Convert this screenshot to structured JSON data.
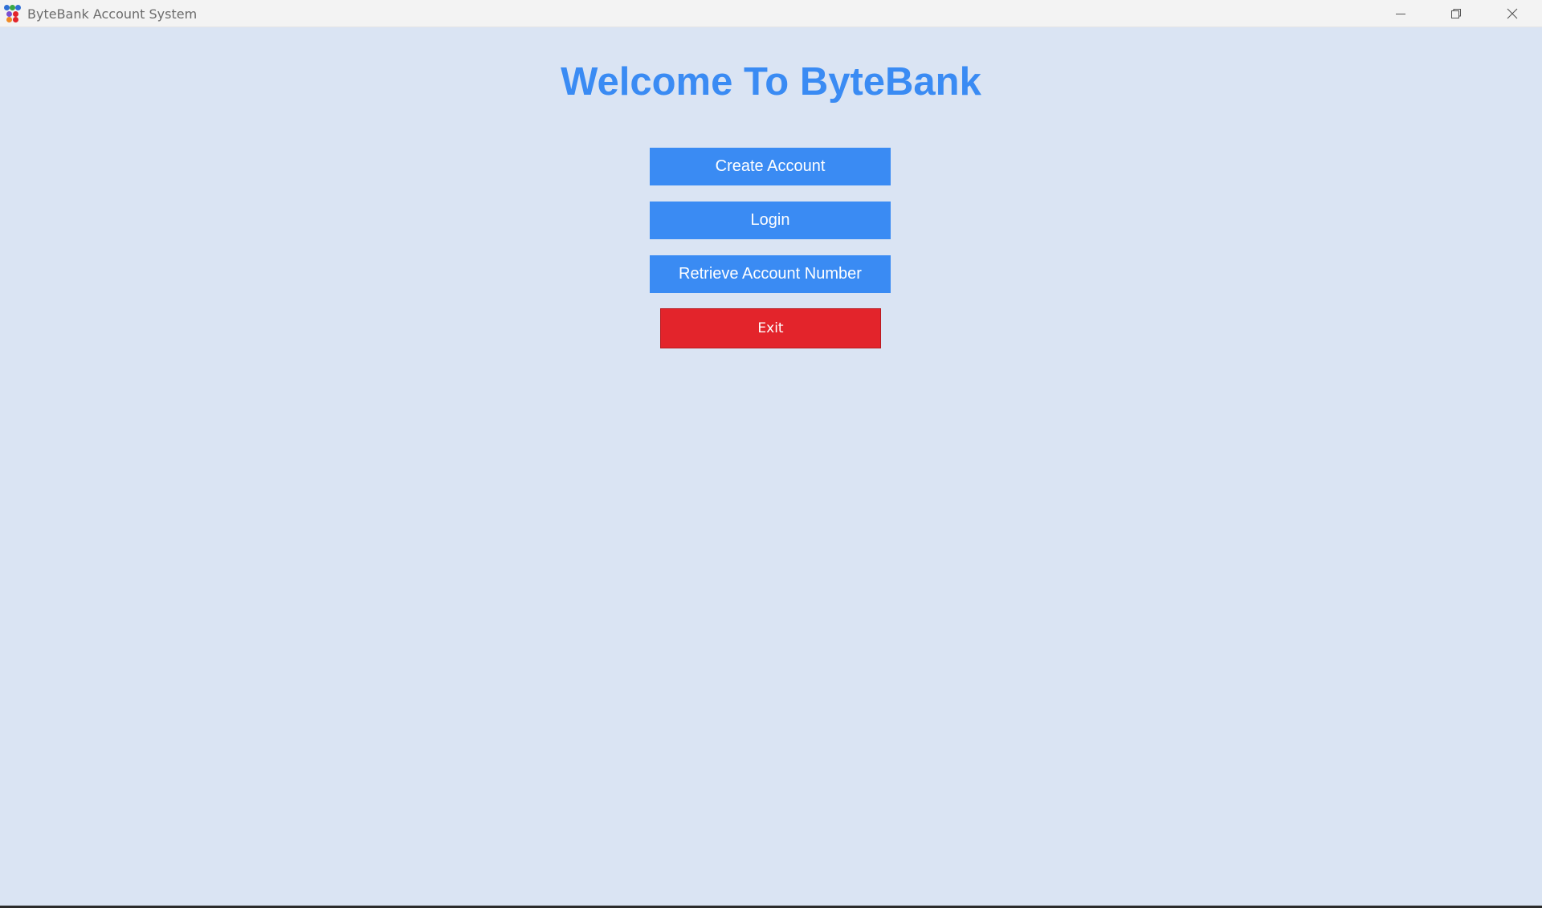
{
  "window": {
    "title": "ByteBank Account System",
    "icon": "app-logo-icon",
    "controls": [
      "minimize-icon",
      "restore-icon",
      "close-icon"
    ]
  },
  "main": {
    "heading": "Welcome To ByteBank",
    "buttons": {
      "create_account": "Create Account",
      "login": "Login",
      "retrieve_account_number": "Retrieve Account Number",
      "exit": "Exit"
    }
  },
  "colors": {
    "background": "#dae4f3",
    "accent_blue": "#3a8bf3",
    "exit_red": "#e3242b",
    "titlebar": "#f3f3f3"
  }
}
